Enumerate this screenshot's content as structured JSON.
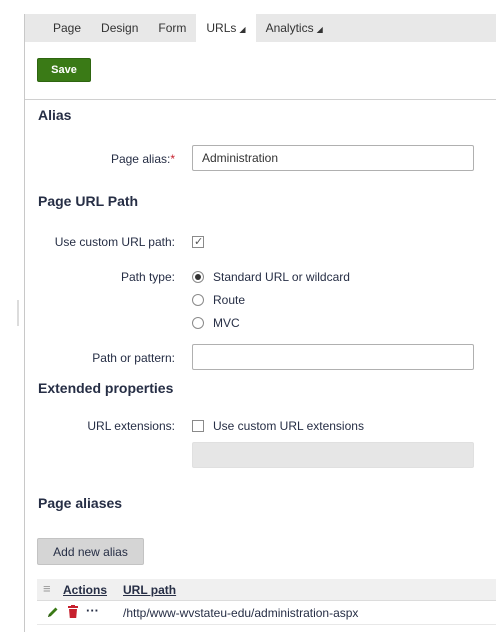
{
  "tabs": [
    {
      "label": "Page",
      "active": false,
      "dropdown": false
    },
    {
      "label": "Design",
      "active": false,
      "dropdown": false
    },
    {
      "label": "Form",
      "active": false,
      "dropdown": false
    },
    {
      "label": "URLs",
      "active": true,
      "dropdown": true
    },
    {
      "label": "Analytics",
      "active": false,
      "dropdown": true
    }
  ],
  "toolbar": {
    "save_label": "Save"
  },
  "alias": {
    "title": "Alias",
    "page_alias_label": "Page alias:",
    "required_mark": "*",
    "page_alias_value": "Administration"
  },
  "url_path": {
    "title": "Page URL Path",
    "custom_label": "Use custom URL path:",
    "custom_checked": true,
    "path_type_label": "Path type:",
    "options": [
      "Standard URL or wildcard",
      "Route",
      "MVC"
    ],
    "selected_option": "Standard URL or wildcard",
    "pattern_label": "Path or pattern:",
    "pattern_value": ""
  },
  "extended": {
    "title": "Extended properties",
    "ext_label": "URL extensions:",
    "ext_checkbox_label": "Use custom URL extensions",
    "ext_checked": false
  },
  "aliases": {
    "title": "Page aliases",
    "add_label": "Add new alias",
    "columns": [
      "Actions",
      "URL path"
    ],
    "rows": [
      {
        "url_path": "/http/www-wvstateu-edu/administration-aspx"
      }
    ]
  },
  "colors": {
    "save_green": "#3a7a16",
    "required_red": "#c7202e",
    "edit_green": "#3a7a16",
    "delete_red": "#c7202e",
    "text_navy": "#262e45"
  },
  "icons": [
    "menu-lines-icon",
    "pencil-icon",
    "trash-icon",
    "ellipsis-icon",
    "checkmark-icon",
    "dropdown-triangle-icon"
  ]
}
